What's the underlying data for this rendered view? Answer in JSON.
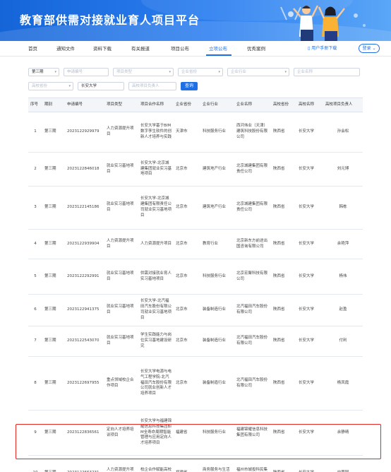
{
  "header": {
    "title": "教育部供需对接就业育人项目平台"
  },
  "nav": {
    "items": [
      "首页",
      "通知文件",
      "资料下载",
      "有关报道",
      "项目公布",
      "立项公布",
      "优秀案例"
    ],
    "active": "立项公布",
    "manual": "用户手册下载",
    "login": "登录"
  },
  "filters": {
    "batch": "第三期",
    "apply_no": "申请编号",
    "project_type": "项目类型",
    "company_province": "企业省份",
    "company_industry": "企业行业",
    "company_name": "企业名称",
    "school_province": "高校省份",
    "school_name": "长安大学",
    "leader": "高校项目负责人",
    "query": "查询"
  },
  "table": {
    "headers": [
      "序号",
      "期别",
      "申请编号",
      "项目类型",
      "项目合作名称",
      "企业省份",
      "企业行业",
      "企业名称",
      "高校省份",
      "高校名称",
      "高校项目负责人"
    ],
    "rows": [
      [
        "1",
        "第三期",
        "2023122929979",
        "人力资源提升项目",
        "长安大学基于BIM数字孪生软件的创新人才培养与实践",
        "天津市",
        "科技服务行业",
        "西河伟业（天津）建筑科技股份有限公司",
        "陕西省",
        "长安大学",
        "孙会松"
      ],
      [
        "2",
        "第三期",
        "2023122846018",
        "就业实习基地项目",
        "长安大学-北京城建集团就业实习基地项目",
        "北京市",
        "建筑地产行业",
        "北京城建集团有限责任公司",
        "陕西省",
        "长安大学",
        "刘元博"
      ],
      [
        "3",
        "第三期",
        "2023122145186",
        "就业实习基地项目",
        "长安大学-北京城建集团有限责任公司就业实习基地项目",
        "北京市",
        "建筑地产行业",
        "北京城建集团有限责任公司",
        "陕西省",
        "长安大学",
        "韩栋"
      ],
      [
        "4",
        "第三期",
        "2023122939904",
        "人力资源提升项目",
        "人力资源提升项目",
        "北京市",
        "教育行业",
        "北京新东方前途出国咨询有限公司",
        "陕西省",
        "长安大学",
        "余艳萍"
      ],
      [
        "5",
        "第三期",
        "2023122292991",
        "就业实习基地项目",
        "供需对接就业育人实习基地项目",
        "北京市",
        "科技服务行业",
        "北京宏聚科技有限公司",
        "陕西省",
        "长安大学",
        "杨伟"
      ],
      [
        "6",
        "第三期",
        "2023122941375",
        "就业实习基地项目",
        "长安大学-北汽福田汽车股份有限公司就业实习基地项目",
        "北京市",
        "装备制造行业",
        "北汽福田汽车股份有限公司",
        "陕西省",
        "长安大学",
        "赵盈"
      ],
      [
        "7",
        "第三期",
        "2023122543070",
        "就业实习基地项目",
        "学生实践能力与岗位实习基地建设研究",
        "北京市",
        "装备制造行业",
        "北汽福田汽车股份有限公司",
        "陕西省",
        "长安大学",
        "付利"
      ],
      [
        "8",
        "第三期",
        "2023122697955",
        "重点领域校企合作项目",
        "长安大学电源与电气工程学院-北汽福田汽车股份有限公司就业创新人才培养项目",
        "北京市",
        "装备制造行业",
        "北汽福田汽车股份有限公司",
        "陕西省",
        "长安大学",
        "杨凤霞"
      ],
      [
        "9",
        "第三期",
        "2023122836561",
        "定向人才培养培训项目",
        "长安大学与福建锦耀信息科技集团BIM全寿命周期智能管理与应用定向人才培养项目",
        "福建省",
        "科技服务行业",
        "福建锦耀信息科技集团有限公司",
        "陕西省",
        "长安大学",
        "余静晴"
      ],
      [
        "10",
        "第三期",
        "2023122663231",
        "人力资源提升项目",
        "校企合作赋能高校师资质量提升",
        "福建省",
        "商务服务与生活消费行业",
        "福州市城投科民集团有限公司",
        "陕西省",
        "长安大学",
        "宁蓉园"
      ]
    ]
  },
  "colors": {
    "brand": "#1f6fe5",
    "highlight": "#e62525",
    "banner": "#2c7ff0"
  }
}
